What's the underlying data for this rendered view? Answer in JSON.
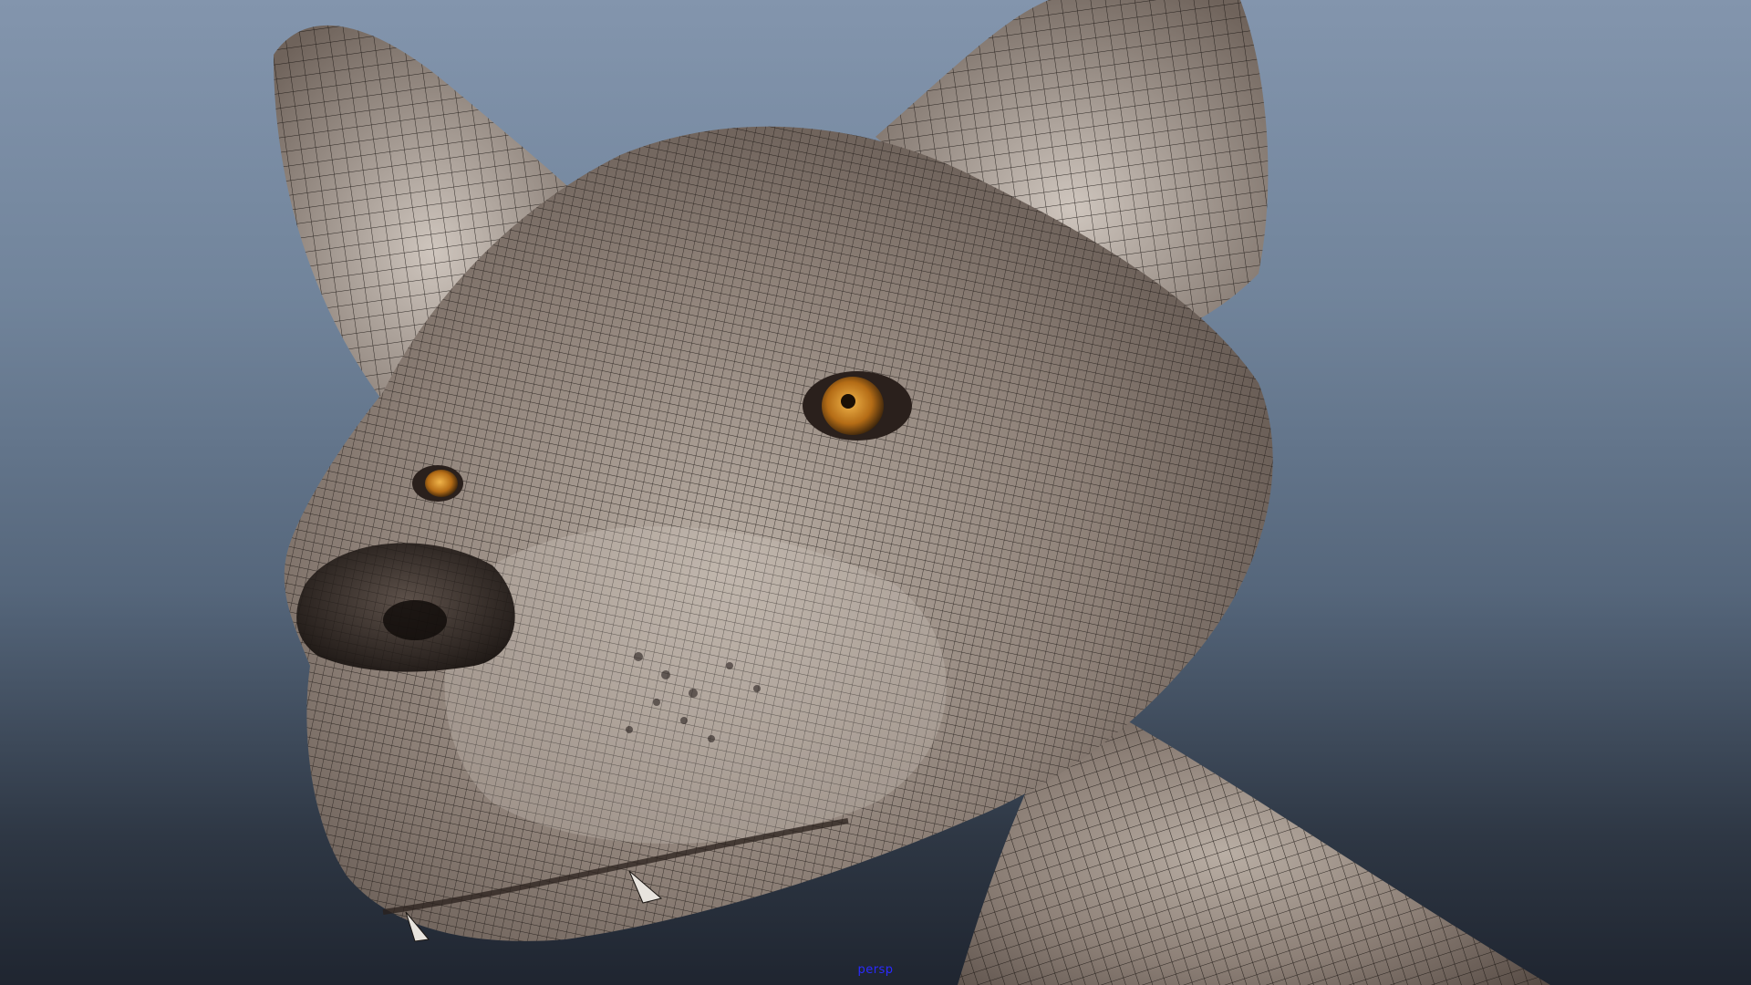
{
  "viewport": {
    "camera_name": "persp",
    "background_top": "#8395ad",
    "background_bottom": "#1f2530",
    "shading_mode": "wireframe-on-shaded"
  },
  "model": {
    "wireframe_color": "#1a1512",
    "skin_color": "#8a7d73",
    "eye_color": "#c88a22",
    "nose_color": "#3a302c"
  }
}
